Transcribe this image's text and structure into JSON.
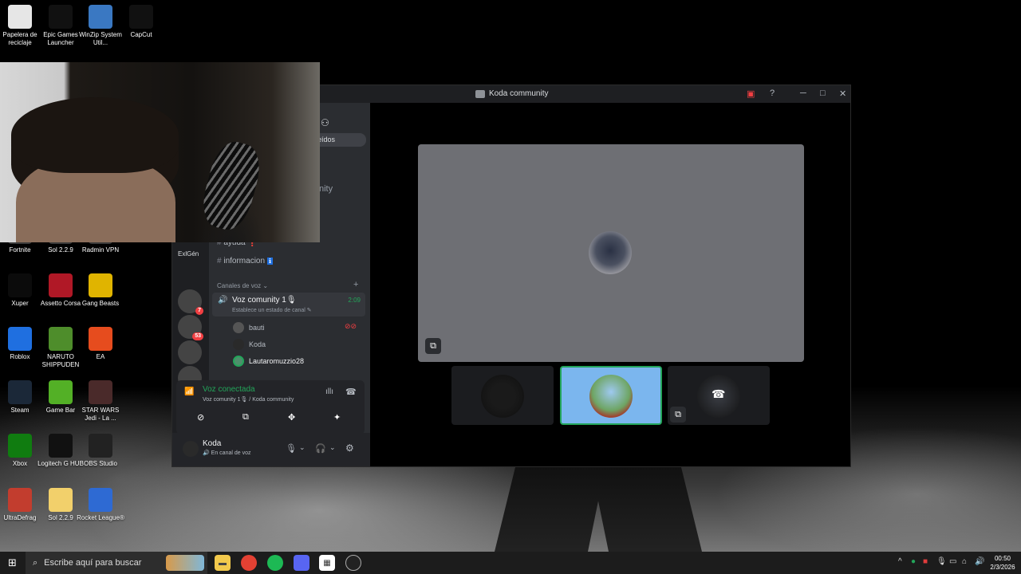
{
  "desktop": {
    "icons": [
      {
        "label": "Papelera de reciclaje",
        "icon": "recycle-bin-icon",
        "color": "#e6e6e6"
      },
      {
        "label": "Epic Games Launcher",
        "icon": "epic-games-icon",
        "color": "#111111"
      },
      {
        "label": "WinZip System Util...",
        "icon": "winzip-icon",
        "color": "#3a78c2"
      },
      {
        "label": "CapCut",
        "icon": "capcut-icon",
        "color": "#111111"
      },
      {
        "label": "Fortnite",
        "icon": "fortnite-icon",
        "color": "#3a3a3a"
      },
      {
        "label": "Sol 2.2.9",
        "icon": "sol-icon",
        "color": "#3a3a3a"
      },
      {
        "label": "Radmin VPN",
        "icon": "radmin-icon",
        "color": "#3a3a3a"
      },
      {
        "label": "Xuper",
        "icon": "xuper-icon",
        "color": "#0b0b0b"
      },
      {
        "label": "Assetto Corsa",
        "icon": "assetto-corsa-icon",
        "color": "#b01826"
      },
      {
        "label": "Gang Beasts",
        "icon": "gang-beasts-icon",
        "color": "#e0b400"
      },
      {
        "label": "Roblox",
        "icon": "roblox-icon",
        "color": "#1f6fe0"
      },
      {
        "label": "NARUTO SHIPPUDEN",
        "icon": "naruto-icon",
        "color": "#4e8d2b"
      },
      {
        "label": "EA",
        "icon": "ea-icon",
        "color": "#e64c1e"
      },
      {
        "label": "Steam",
        "icon": "steam-icon",
        "color": "#1b2838"
      },
      {
        "label": "Game Bar",
        "icon": "game-bar-icon",
        "color": "#53b026"
      },
      {
        "label": "STAR WARS Jedi - La ...",
        "icon": "star-wars-icon",
        "color": "#4a2a2a"
      },
      {
        "label": "Xbox",
        "icon": "xbox-icon",
        "color": "#107c10"
      },
      {
        "label": "Logitech G HUB",
        "icon": "logitech-icon",
        "color": "#111111"
      },
      {
        "label": "OBS Studio",
        "icon": "obs-icon",
        "color": "#222222"
      },
      {
        "label": "UltraDefrag",
        "icon": "ultradefrag-icon",
        "color": "#c23d2e"
      },
      {
        "label": "Sol 2.2.9",
        "icon": "folder-icon",
        "color": "#f2d06b"
      },
      {
        "label": "Rocket League®",
        "icon": "rocket-league-icon",
        "color": "#2e6ad3"
      }
    ]
  },
  "discord": {
    "window_title": "Koda community",
    "title_controls": {
      "minimize": "─",
      "maximize": "□",
      "close": "✕"
    },
    "sidebar": {
      "tab_partial": "eídos",
      "partial_text": "nity",
      "guilds": [
        {
          "label": "ExlGén",
          "badge": ""
        },
        {
          "label": "",
          "badge": "7"
        },
        {
          "label": "",
          "badge": "53"
        },
        {
          "label": "",
          "badge": ""
        },
        {
          "label": "",
          "badge": ""
        }
      ],
      "text_channels": [
        {
          "name": "ayuda",
          "emoji": "❗"
        },
        {
          "name": "informacion",
          "emoji": "ℹ"
        }
      ],
      "voice_category": "Canales de voz",
      "voice_channel": {
        "name": "Voz comunity 1🎙",
        "time": "2:09",
        "status": "Establece un estado de canal"
      },
      "voice_users": [
        "bauti",
        "Koda",
        "Lautaromuzzio28"
      ]
    },
    "voice_panel": {
      "status": "Voz conectada",
      "detail": "Voz comunity 1🎙 / Koda community"
    },
    "user_panel": {
      "name": "Koda",
      "status": "En canal de voz"
    }
  },
  "taskbar": {
    "search_placeholder": "Escribe aquí para buscar",
    "time": "00:50",
    "date": "2/3/2026"
  }
}
